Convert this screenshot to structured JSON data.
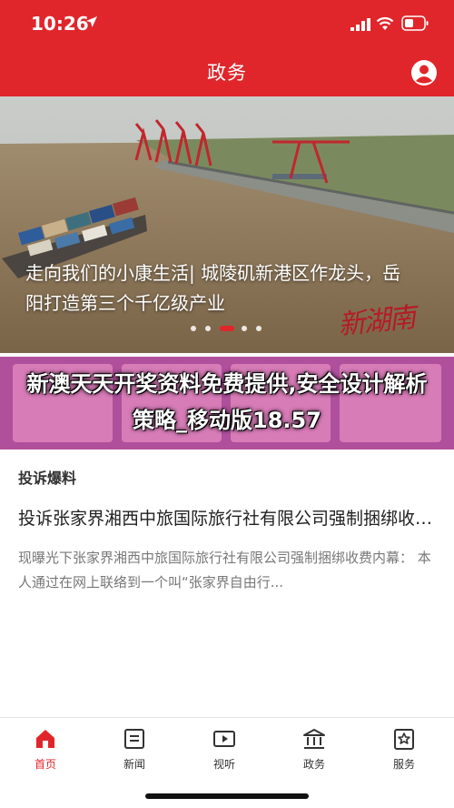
{
  "status_bar": {
    "time": "10:26"
  },
  "header": {
    "title": "政务"
  },
  "banner": {
    "caption": "走向我们的小康生活| 城陵矶新港区作龙头，岳阳打造第三个千亿级产业",
    "stamp": "新湖南",
    "slide_count": 5,
    "active_slide": 3
  },
  "promo": {
    "text": "新澳天天开奖资料免费提供,安全设计解析策略_移动版18.57"
  },
  "complaints": {
    "section_title": "投诉爆料",
    "article_title": "投诉张家界湘西中旅国际旅行社有限公司强制捆绑收费内幕",
    "article_summary": "现曝光下张家界湘西中旅国际旅行社有限公司强制捆绑收费内幕：   本人通过在网上联络到一个叫“张家界自由行..."
  },
  "tabbar": {
    "items": [
      {
        "label": "首页",
        "icon": "home-icon",
        "active": true
      },
      {
        "label": "新闻",
        "icon": "news-icon",
        "active": false
      },
      {
        "label": "视听",
        "icon": "video-icon",
        "active": false
      },
      {
        "label": "政务",
        "icon": "government-icon",
        "active": false
      },
      {
        "label": "服务",
        "icon": "service-icon",
        "active": false
      }
    ]
  },
  "colors": {
    "brand_red": "#e0262b",
    "promo_purple": "#b0509c"
  }
}
